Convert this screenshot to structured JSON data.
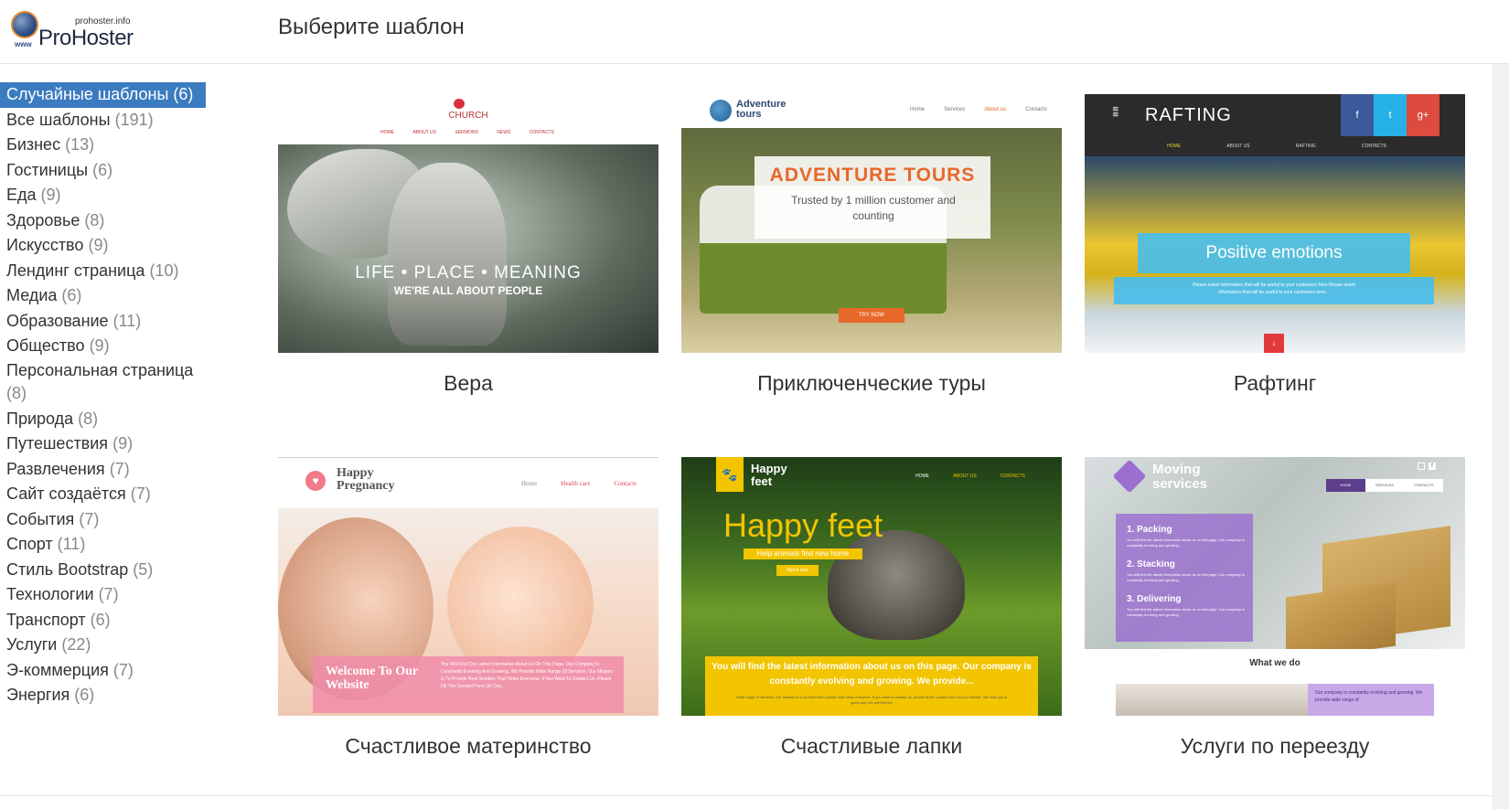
{
  "logo": {
    "small_text": "prohoster.info",
    "main_text": "ProHoster",
    "www": "www"
  },
  "page_title": "Выберите шаблон",
  "categories": [
    {
      "label": "Случайные шаблоны",
      "count": "(6)",
      "active": true
    },
    {
      "label": "Все шаблоны",
      "count": "(191)"
    },
    {
      "label": "Бизнес",
      "count": "(13)"
    },
    {
      "label": "Гостиницы",
      "count": "(6)"
    },
    {
      "label": "Еда",
      "count": "(9)"
    },
    {
      "label": "Здоровье",
      "count": "(8)"
    },
    {
      "label": "Искусство",
      "count": "(9)"
    },
    {
      "label": "Лендинг страница",
      "count": "(10)"
    },
    {
      "label": "Медиа",
      "count": "(6)"
    },
    {
      "label": "Образование",
      "count": "(11)"
    },
    {
      "label": "Общество",
      "count": "(9)"
    },
    {
      "label": "Персональная страница",
      "count": "(8)"
    },
    {
      "label": "Природа",
      "count": "(8)"
    },
    {
      "label": "Путешествия",
      "count": "(9)"
    },
    {
      "label": "Развлечения",
      "count": "(7)"
    },
    {
      "label": "Сайт создаётся",
      "count": "(7)"
    },
    {
      "label": "События",
      "count": "(7)"
    },
    {
      "label": "Спорт",
      "count": "(11)"
    },
    {
      "label": "Стиль Bootstrap",
      "count": "(5)"
    },
    {
      "label": "Технологии",
      "count": "(7)"
    },
    {
      "label": "Транспорт",
      "count": "(6)"
    },
    {
      "label": "Услуги",
      "count": "(22)"
    },
    {
      "label": "Э-коммерция",
      "count": "(7)"
    },
    {
      "label": "Энергия",
      "count": "(6)"
    }
  ],
  "templates": [
    {
      "title": "Вера",
      "thumb": {
        "brand": "CHURCH",
        "nav": [
          "HOME",
          "ABOUT US",
          "SERMONS",
          "NEWS",
          "CONTACTS"
        ],
        "headline": "LIFE  •  PLACE  •  MEANING",
        "subline": "WE'RE ALL ABOUT PEOPLE"
      }
    },
    {
      "title": "Приключенческие туры",
      "thumb": {
        "brand_line1": "Adventure",
        "brand_line2": "tours",
        "nav": [
          "Home",
          "Services",
          "About us",
          "Contacts"
        ],
        "headline": "ADVENTURE TOURS",
        "subline": "Trusted by 1 million customer and counting",
        "button": "TRY NOW"
      }
    },
    {
      "title": "Рафтинг",
      "thumb": {
        "brand": "RAFTING",
        "nav": [
          "HOME",
          "ABOUT US",
          "RAFTING",
          "CONTACTS"
        ],
        "social": [
          "f",
          "t",
          "g+"
        ],
        "headline": "Positive emotions",
        "subline": "Please insert information that will be useful to your customers here Please insert information that will be useful to your customers here...",
        "arrow": "↓"
      }
    },
    {
      "title": "Счастливое материнство",
      "thumb": {
        "brand_line1": "Happy",
        "brand_line2": "Pregnancy",
        "nav": [
          "Home",
          "Health care",
          "Contacts"
        ],
        "headline": "Welcome To Our Website",
        "subline": "You Will Find The Latest Information About Us On This Page. Our Company Is Constantly Evolving And Growing. We Provide Wide Range Of Services. Our Mission Is To Provide Best Solution That Helps Everyone. If You Want To Contact Us, Please Fill The Contact Form On Our..."
      }
    },
    {
      "title": "Счастливые лапки",
      "thumb": {
        "brand_line1": "Happy",
        "brand_line2": "feet",
        "nav": [
          "HOME",
          "ABOUT US",
          "CONTACTS"
        ],
        "headline": "Happy feet",
        "subline": "Help animals find new home",
        "button": "About now",
        "banner": "You will find the latest information about us on this page. Our company is constantly evolving and growing. We provide...",
        "banner_small": "Wide range of services. Our mission is to provide best solution that helps everyone. If you want to contact us, please fill the contact form on our website. We wish you a good day! We will find the"
      }
    },
    {
      "title": "Услуги по переезду",
      "thumb": {
        "brand_line1": "Moving",
        "brand_line2": "services",
        "nav": [
          "HOME",
          "SERVICES",
          "CONTACTS"
        ],
        "steps": [
          "1. Packing",
          "2. Stacking",
          "3. Delivering"
        ],
        "step_text": "You will find the latest information about us on this page. Our company is constantly evolving and growing.",
        "section": "What we do",
        "section_text": "Our company is constantly evolving and growing. We provide wide range of"
      }
    }
  ],
  "colors": {
    "active_bg": "#3b7bbf",
    "count": "#888888",
    "title": "#333333"
  }
}
